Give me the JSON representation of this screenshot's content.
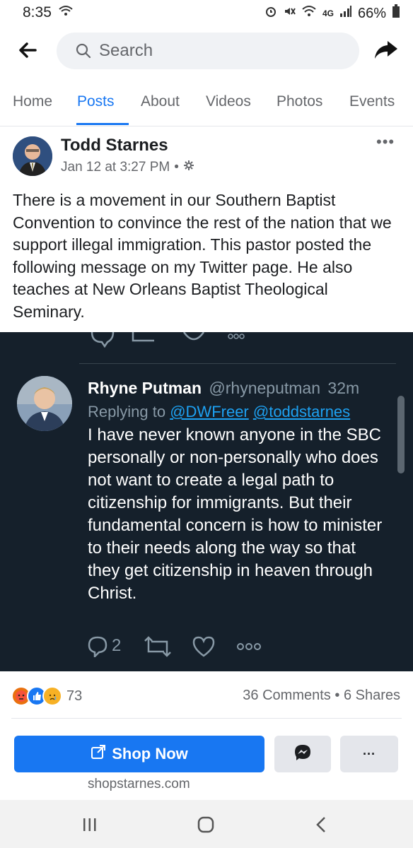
{
  "status_bar": {
    "time": "8:35",
    "battery": "66%",
    "network": "4G"
  },
  "search": {
    "placeholder": "Search"
  },
  "tabs": [
    {
      "label": "Home"
    },
    {
      "label": "Posts",
      "active": true
    },
    {
      "label": "About"
    },
    {
      "label": "Videos"
    },
    {
      "label": "Photos"
    },
    {
      "label": "Events"
    }
  ],
  "post": {
    "author": "Todd Starnes",
    "timestamp": "Jan 12 at 3:27 PM",
    "separator": "•",
    "text": "There is a movement in our Southern Baptist Convention to convince the rest of the nation that we support illegal immigration. This pastor posted the following message on my Twitter page. He also teaches at New Orleans Baptist Theological Seminary."
  },
  "tweet": {
    "name": "Rhyne Putman",
    "handle": "@rhyneputman",
    "age": "32m",
    "replying_label": "Replying to",
    "reply_to_1": "@DWFreer",
    "reply_to_2": "@toddstarnes",
    "body": "I have never known anyone in the SBC personally or non-personally who does not want to create a legal path to citizenship for immigrants. But their fundamental concern is how to minister to their needs along the way so that they get citizenship in heaven through Christ.",
    "reply_count": "2"
  },
  "engagement": {
    "reaction_count": "73",
    "comments": "36 Comments",
    "dot": "•",
    "shares": "6 Shares"
  },
  "shop": {
    "button_label": "Shop Now",
    "domain": "shopstarnes.com",
    "more_label": "···"
  },
  "colors": {
    "brand": "#1877f2",
    "tweet_bg": "#15202b",
    "tweet_link": "#1da1f2"
  }
}
